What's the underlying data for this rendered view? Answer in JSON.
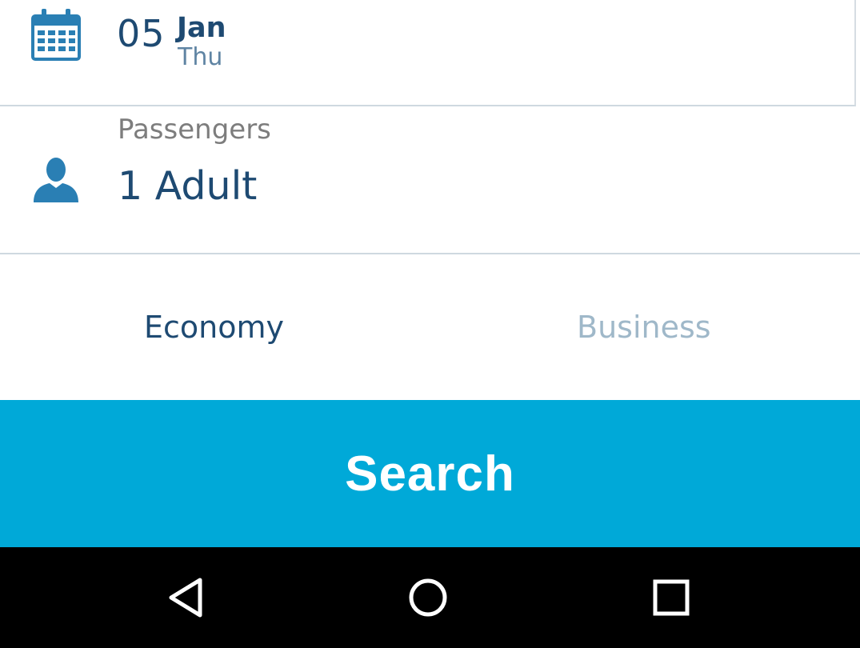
{
  "date": {
    "day": "05",
    "month": "Jan",
    "weekday": "Thu",
    "icon": "calendar-icon"
  },
  "passengers": {
    "label": "Passengers",
    "value": "1 Adult",
    "icon": "person-icon"
  },
  "cabin": {
    "options": [
      "Economy",
      "Business"
    ],
    "selected": "Economy"
  },
  "search": {
    "label": "Search"
  },
  "colors": {
    "accent": "#00a9d8",
    "primary_text": "#1e4a72",
    "icon": "#2a7fb4",
    "inactive_tab": "#9fb8c9",
    "label_grey": "#7d7d7d"
  },
  "nav": {
    "icons": [
      "back-icon",
      "home-icon",
      "recents-icon"
    ]
  }
}
